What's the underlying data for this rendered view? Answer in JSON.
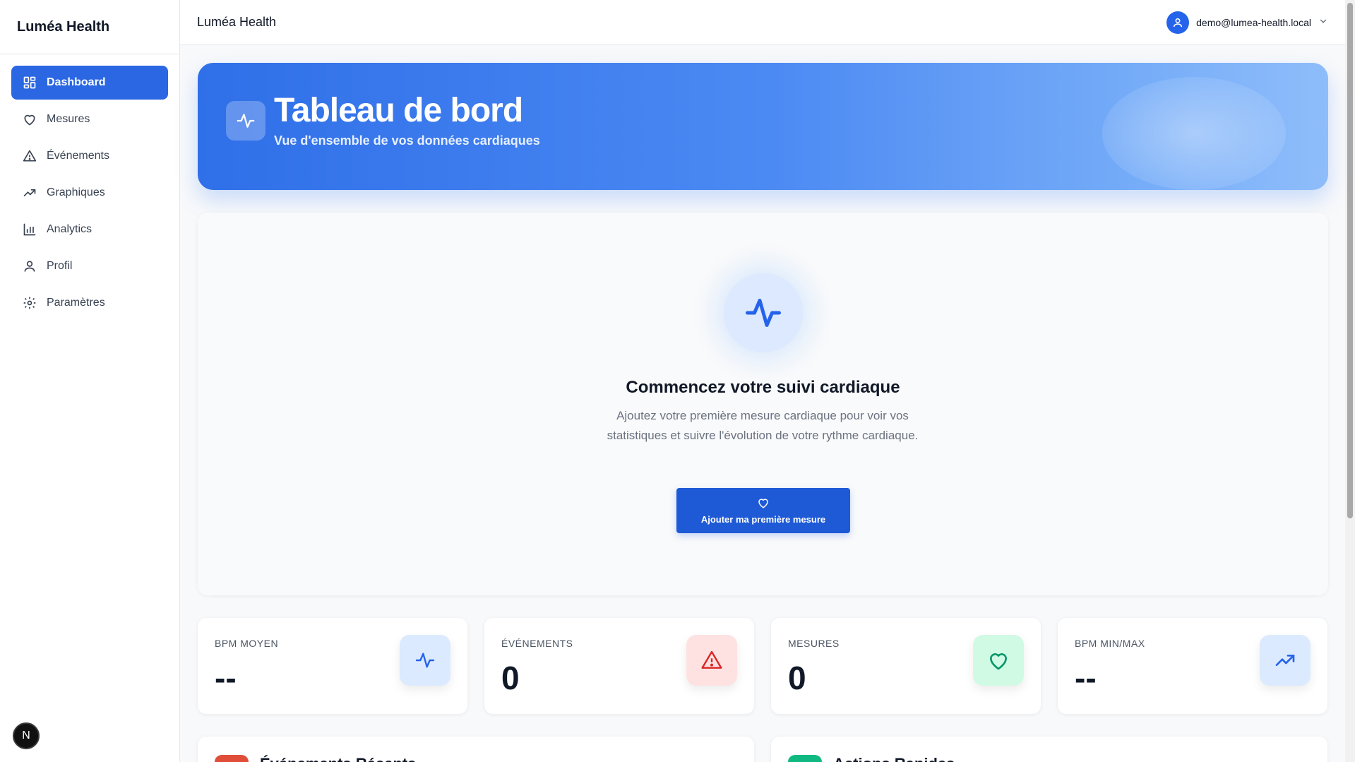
{
  "app": {
    "name": "Luméa Health"
  },
  "sidebar": {
    "items": [
      {
        "label": "Dashboard",
        "icon": "dashboard-grid-icon",
        "active": true
      },
      {
        "label": "Mesures",
        "icon": "heart-icon",
        "active": false
      },
      {
        "label": "Événements",
        "icon": "warning-triangle-icon",
        "active": false
      },
      {
        "label": "Graphiques",
        "icon": "trending-up-icon",
        "active": false
      },
      {
        "label": "Analytics",
        "icon": "bar-chart-icon",
        "active": false
      },
      {
        "label": "Profil",
        "icon": "user-icon",
        "active": false
      },
      {
        "label": "Paramètres",
        "icon": "gear-icon",
        "active": false
      }
    ],
    "badge": "N"
  },
  "topbar": {
    "title": "Luméa Health",
    "user_email": "demo@lumea-health.local"
  },
  "hero": {
    "title": "Tableau de bord",
    "subtitle": "Vue d'ensemble de vos données cardiaques"
  },
  "empty_state": {
    "title": "Commencez votre suivi cardiaque",
    "text": "Ajoutez votre première mesure cardiaque pour voir vos statistiques et suivre l'évolution de votre rythme cardiaque.",
    "cta_label": "Ajouter ma première mesure"
  },
  "stats": [
    {
      "label": "BPM MOYEN",
      "value": "--",
      "icon": "activity-icon"
    },
    {
      "label": "ÉVÉNEMENTS",
      "value": "0",
      "icon": "warning-triangle-icon"
    },
    {
      "label": "MESURES",
      "value": "0",
      "icon": "heart-icon"
    },
    {
      "label": "BPM MIN/MAX",
      "value": "--",
      "icon": "trending-up-icon"
    }
  ],
  "bottom_cards": [
    {
      "title": "Événements Récents"
    },
    {
      "title": "Actions Rapides"
    }
  ],
  "colors": {
    "accent": "#2b67e3",
    "stat_bpm_bg": "#dbeafe",
    "stat_events_bg": "#fee2e2",
    "stat_measures_bg": "#d1fae5",
    "stat_minmax_bg": "#dbeafe"
  }
}
